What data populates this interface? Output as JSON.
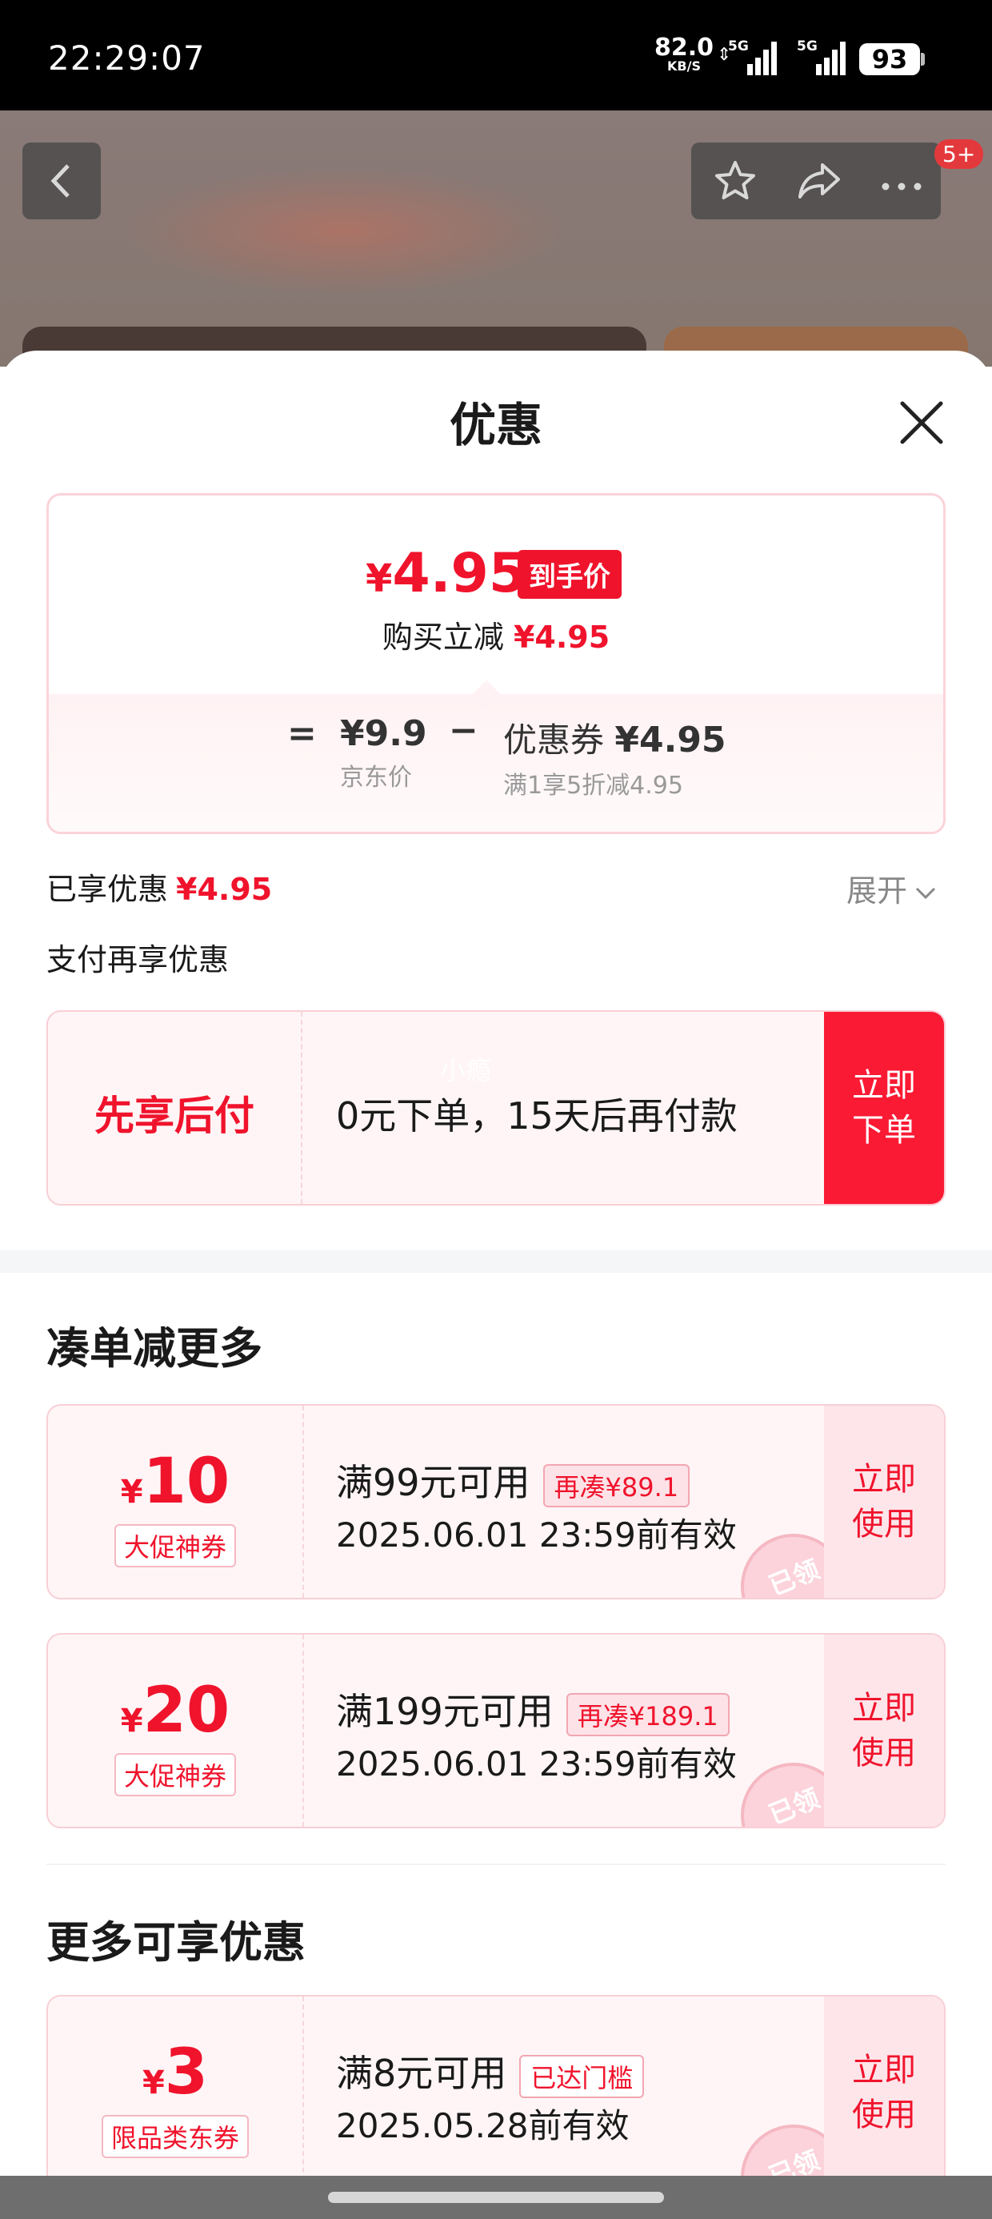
{
  "status_bar": {
    "time": "22:29:07",
    "net_speed": "82.0",
    "net_unit": "KB/S",
    "signal1_label": "5G",
    "signal2_label": "5G",
    "battery": "93"
  },
  "background_page": {
    "badge": "5+"
  },
  "sheet": {
    "title": "优惠",
    "price_summary": {
      "currency": "¥",
      "final_price": "4.95",
      "final_price_tag": "到手价",
      "reduce_label": "购买立减",
      "reduce_amount": "¥4.95",
      "equals": "=",
      "jd_price": "¥9.9",
      "jd_price_label": "京东价",
      "minus": "−",
      "coupon_label": "优惠券",
      "coupon_amount": "¥4.95",
      "coupon_desc": "满1享5折减4.95"
    },
    "enjoyed_label": "已享优惠",
    "enjoyed_amount": "¥4.95",
    "expand_label": "展开",
    "pay_again_label": "支付再享优惠",
    "pay_later": {
      "title": "先享后付",
      "desc": "0元下单，15天后再付款",
      "watermark": "小瘾",
      "button": "立即下单"
    },
    "section_more": {
      "title": "凑单减更多",
      "coupons": [
        {
          "currency": "¥",
          "amount": "10",
          "tag": "大促神券",
          "condition": "满99元可用",
          "pill": "再凑¥89.1",
          "date": "2025.06.01 23:59前有效",
          "button": "立即使用",
          "stamp": "已领"
        },
        {
          "currency": "¥",
          "amount": "20",
          "tag": "大促神券",
          "condition": "满199元可用",
          "pill": "再凑¥189.1",
          "date": "2025.06.01 23:59前有效",
          "button": "立即使用",
          "stamp": "已领"
        }
      ]
    },
    "section_extra": {
      "title": "更多可享优惠",
      "coupons": [
        {
          "currency": "¥",
          "amount": "3",
          "tag": "限品类东券",
          "condition": "满8元可用",
          "pill": "已达门槛",
          "date": "2025.05.28前有效",
          "button": "立即使用",
          "stamp": "已领"
        }
      ]
    }
  },
  "colors": {
    "accent_red": "#f0132c",
    "coupon_bg": "#fff5f6",
    "coupon_border": "#f8cfd6"
  }
}
